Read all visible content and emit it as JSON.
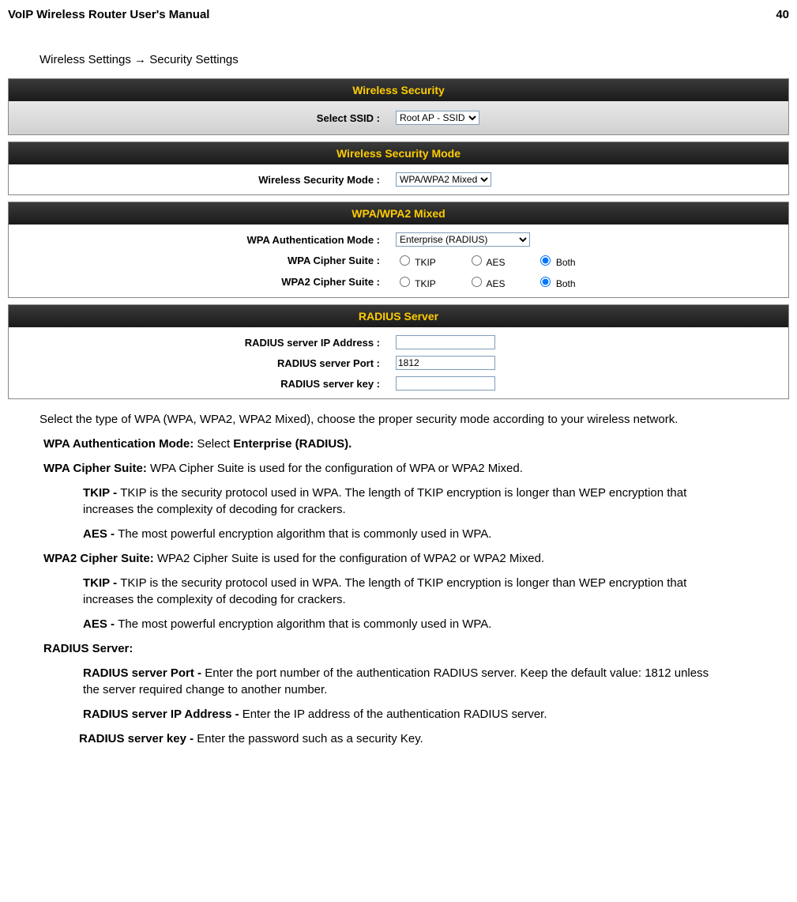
{
  "page": {
    "title": "VoIP Wireless Router User's Manual",
    "number": "40"
  },
  "breadcrumb": "Wireless Settings  →  Security Settings",
  "panel1": {
    "title": "Wireless Security",
    "ssid_label": "Select SSID :",
    "ssid_value": "Root AP - SSID"
  },
  "panel2": {
    "title": "Wireless Security Mode",
    "mode_label": "Wireless Security Mode :",
    "mode_value": "WPA/WPA2 Mixed"
  },
  "panel3": {
    "title": "WPA/WPA2 Mixed",
    "auth_label": "WPA Authentication Mode :",
    "auth_value": "Enterprise (RADIUS)",
    "wpa_label": "WPA Cipher Suite :",
    "wpa2_label": "WPA2 Cipher Suite :",
    "opt_tkip": "TKIP",
    "opt_aes": "AES",
    "opt_both": "Both"
  },
  "panel4": {
    "title": "RADIUS Server",
    "ip_label": "RADIUS server IP Address :",
    "ip_value": "",
    "port_label": "RADIUS server Port :",
    "port_value": "1812",
    "key_label": "RADIUS server key :",
    "key_value": ""
  },
  "text": {
    "intro": "Select the type of WPA (WPA, WPA2, WPA2 Mixed), choose the proper security mode according to your wireless network.",
    "auth_b": "WPA Authentication Mode:",
    "auth_t": " Select ",
    "auth_b2": "Enterprise (RADIUS).",
    "wpa_b": "WPA Cipher Suite:",
    "wpa_t": " WPA Cipher Suite is used for the configuration of WPA or WPA2 Mixed.",
    "tkip_b": "TKIP - ",
    "tkip_t": "TKIP is the security protocol used in WPA. The length of TKIP encryption is longer than WEP encryption that increases the complexity of decoding for crackers.",
    "aes_b": "AES - ",
    "aes_t": "The most powerful encryption algorithm that is commonly used in WPA.",
    "wpa2_b": "WPA2 Cipher Suite:",
    "wpa2_t": " WPA2 Cipher Suite is used for the configuration of WPA2 or WPA2 Mixed.",
    "tkip2_b": "TKIP - ",
    "tkip2_t": "TKIP is the security protocol used in WPA. The length of TKIP encryption is longer than WEP encryption that increases the complexity of decoding for crackers.",
    "aes2_b": "AES - ",
    "aes2_t": "The most powerful encryption algorithm that is commonly used in WPA.",
    "radius_h": "RADIUS Server:",
    "rport_b": "RADIUS server Port - ",
    "rport_t": "Enter the port number of the authentication RADIUS server. Keep the default value: 1812 unless the server required change to another number.",
    "rip_b": "RADIUS server IP Address - ",
    "rip_t": "Enter the IP address of the authentication RADIUS server.",
    "rkey_b": "RADIUS server key - ",
    "rkey_t": "Enter the password such as a security Key."
  }
}
